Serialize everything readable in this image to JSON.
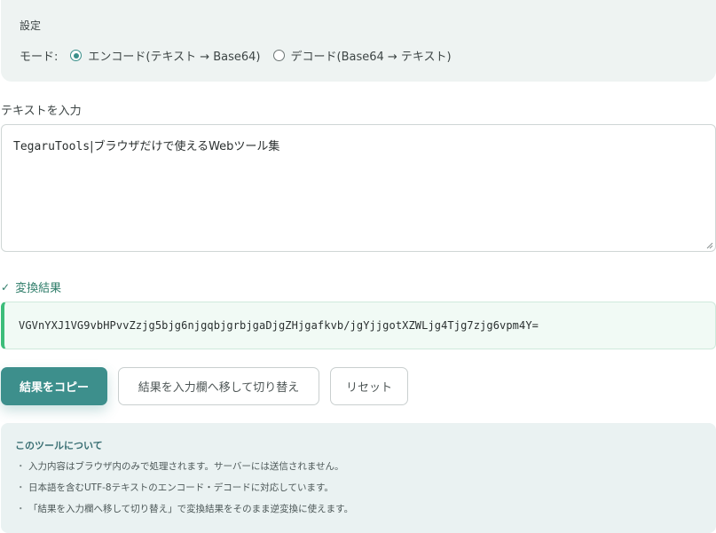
{
  "settings": {
    "title": "設定",
    "mode_label": "モード:",
    "options": [
      {
        "label": "エンコード(テキスト → Base64)",
        "checked": true
      },
      {
        "label": "デコード(Base64 → テキスト)",
        "checked": false
      }
    ]
  },
  "input": {
    "label": "テキストを入力",
    "value_prefix": "TegaruTools",
    "value_rest": "|ブラウザだけで使えるWebツール集"
  },
  "result": {
    "label": "変換結果",
    "value": "VGVnYXJ1VG9vbHPvvZzjg5bjg6njgqbjgrbjgaDjgZHjgafkvb/jgYjjgotXZWLjg4Tjg7zjg6vpm4Y="
  },
  "buttons": {
    "copy": "結果をコピー",
    "swap": "結果を入力欄へ移して切り替え",
    "reset": "リセット"
  },
  "about": {
    "title": "このツールについて",
    "items": [
      "入力内容はブラウザ内のみで処理されます。サーバーには送信されません。",
      "日本語を含むUTF-8テキストのエンコード・デコードに対応しています。",
      "「結果を入力欄へ移して切り替え」で変換結果をそのまま逆変換に使えます。"
    ]
  },
  "colors": {
    "accent": "#3d8f8c",
    "success": "#3dbd7a",
    "panel_bg": "#eef3f2"
  }
}
